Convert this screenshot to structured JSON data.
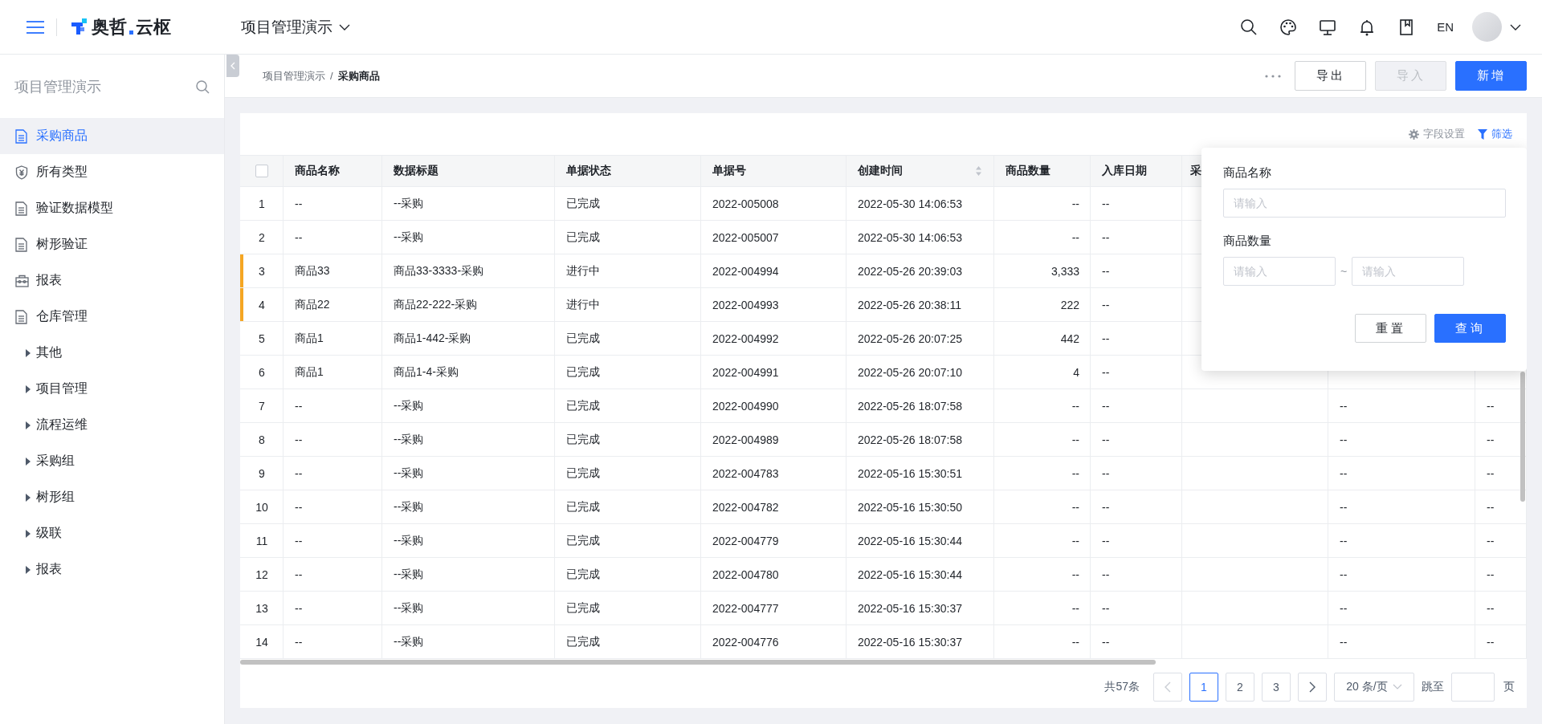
{
  "header": {
    "logo": {
      "first": "奥哲",
      "second": "云枢"
    },
    "project": "项目管理演示",
    "language": "EN"
  },
  "sidebar": {
    "title": "项目管理演示",
    "items": [
      {
        "label": "采购商品",
        "kind": "document",
        "selected": true
      },
      {
        "label": "所有类型",
        "kind": "finance",
        "selected": false
      },
      {
        "label": "验证数据模型",
        "kind": "document",
        "selected": false
      },
      {
        "label": "树形验证",
        "kind": "document",
        "selected": false
      },
      {
        "label": "报表",
        "kind": "report",
        "selected": false
      },
      {
        "label": "仓库管理",
        "kind": "document",
        "selected": false
      },
      {
        "label": "其他",
        "kind": "group",
        "selected": false,
        "expanded": false
      },
      {
        "label": "项目管理",
        "kind": "group",
        "selected": false,
        "expanded": false
      },
      {
        "label": "流程运维",
        "kind": "group",
        "selected": false,
        "expanded": false
      },
      {
        "label": "采购组",
        "kind": "group",
        "selected": false,
        "expanded": false
      },
      {
        "label": "树形组",
        "kind": "group",
        "selected": false,
        "expanded": false
      },
      {
        "label": "级联",
        "kind": "group",
        "selected": false,
        "expanded": false
      },
      {
        "label": "报表",
        "kind": "group",
        "selected": false,
        "expanded": false
      }
    ]
  },
  "breadcrumb": {
    "separator": "/",
    "items": [
      {
        "label": "项目管理演示",
        "current": false
      },
      {
        "label": "采购商品",
        "current": true
      }
    ]
  },
  "actions": [
    {
      "label": "导出",
      "kind": "default",
      "disabled": false
    },
    {
      "label": "导入",
      "kind": "default",
      "disabled": true
    },
    {
      "label": "新增",
      "kind": "primary",
      "disabled": false
    }
  ],
  "toolbar": [
    {
      "label": "字段设置",
      "kind": "settings",
      "active": false
    },
    {
      "label": "筛选",
      "kind": "filter",
      "active": true
    }
  ],
  "table": {
    "select_all": {
      "checked": false
    },
    "columns": [
      {
        "label": "商品名称",
        "sortable": false
      },
      {
        "label": "数据标题",
        "sortable": false
      },
      {
        "label": "单据状态",
        "sortable": false
      },
      {
        "label": "单据号",
        "sortable": false
      },
      {
        "label": "创建时间",
        "sortable": true
      },
      {
        "label": "商品数量",
        "sortable": false
      },
      {
        "label": "入库日期",
        "sortable": false
      },
      {
        "label": "采"
      }
    ],
    "rows": [
      {
        "index": "1",
        "marked": false,
        "cells": [
          "--",
          "--采购",
          "已完成",
          "2022-005008",
          "2022-05-30 14:06:53",
          "--",
          "--"
        ]
      },
      {
        "index": "2",
        "marked": false,
        "cells": [
          "--",
          "--采购",
          "已完成",
          "2022-005007",
          "2022-05-30 14:06:53",
          "--",
          "--"
        ]
      },
      {
        "index": "3",
        "marked": true,
        "cells": [
          "商品33",
          "商品33-3333-采购",
          "进行中",
          "2022-004994",
          "2022-05-26 20:39:03",
          "3,333",
          "--"
        ]
      },
      {
        "index": "4",
        "marked": true,
        "cells": [
          "商品22",
          "商品22-222-采购",
          "进行中",
          "2022-004993",
          "2022-05-26 20:38:11",
          "222",
          "--"
        ]
      },
      {
        "index": "5",
        "marked": false,
        "cells": [
          "商品1",
          "商品1-442-采购",
          "已完成",
          "2022-004992",
          "2022-05-26 20:07:25",
          "442",
          "--"
        ]
      },
      {
        "index": "6",
        "marked": false,
        "cells": [
          "商品1",
          "商品1-4-采购",
          "已完成",
          "2022-004991",
          "2022-05-26 20:07:10",
          "4",
          "--"
        ]
      },
      {
        "index": "7",
        "marked": false,
        "cells": [
          "--",
          "--采购",
          "已完成",
          "2022-004990",
          "2022-05-26 18:07:58",
          "--",
          "--"
        ],
        "column_10": "--",
        "column_11": "--"
      },
      {
        "index": "8",
        "marked": false,
        "cells": [
          "--",
          "--采购",
          "已完成",
          "2022-004989",
          "2022-05-26 18:07:58",
          "--",
          "--"
        ],
        "column_10": "--",
        "column_11": "--"
      },
      {
        "index": "9",
        "marked": false,
        "cells": [
          "--",
          "--采购",
          "已完成",
          "2022-004783",
          "2022-05-16 15:30:51",
          "--",
          "--"
        ],
        "column_10": "--",
        "column_11": "--"
      },
      {
        "index": "10",
        "marked": false,
        "cells": [
          "--",
          "--采购",
          "已完成",
          "2022-004782",
          "2022-05-16 15:30:50",
          "--",
          "--"
        ],
        "column_10": "--",
        "column_11": "--"
      },
      {
        "index": "11",
        "marked": false,
        "cells": [
          "--",
          "--采购",
          "已完成",
          "2022-004779",
          "2022-05-16 15:30:44",
          "--",
          "--"
        ],
        "column_10": "--",
        "column_11": "--"
      },
      {
        "index": "12",
        "marked": false,
        "cells": [
          "--",
          "--采购",
          "已完成",
          "2022-004780",
          "2022-05-16 15:30:44",
          "--",
          "--"
        ],
        "column_10": "--",
        "column_11": "--"
      },
      {
        "index": "13",
        "marked": false,
        "cells": [
          "--",
          "--采购",
          "已完成",
          "2022-004777",
          "2022-05-16 15:30:37",
          "--",
          "--"
        ],
        "column_10": "--",
        "column_11": "--"
      },
      {
        "index": "14",
        "marked": false,
        "cells": [
          "--",
          "--采购",
          "已完成",
          "2022-004776",
          "2022-05-16 15:30:37",
          "--",
          "--"
        ],
        "column_10": "--",
        "column_11": "--"
      }
    ]
  },
  "filter": {
    "fields": [
      {
        "label": "商品名称",
        "kind": "text",
        "placeholder": "请输入"
      },
      {
        "label": "商品数量",
        "kind": "range",
        "placeholder_from": "请输入",
        "separator": "~",
        "placeholder_to": "请输入"
      }
    ],
    "buttons": [
      {
        "label": "重置",
        "kind": "default"
      },
      {
        "label": "查询",
        "kind": "primary"
      }
    ]
  },
  "pagination": {
    "total": "共57条",
    "prev": {
      "disabled": true
    },
    "pages": [
      {
        "label": "1",
        "selected": true
      },
      {
        "label": "2",
        "selected": false
      },
      {
        "label": "3",
        "selected": false
      }
    ],
    "next": {
      "disabled": false
    },
    "page_size": "20 条/页",
    "jump_label": "跳至",
    "page_suffix": "页"
  }
}
